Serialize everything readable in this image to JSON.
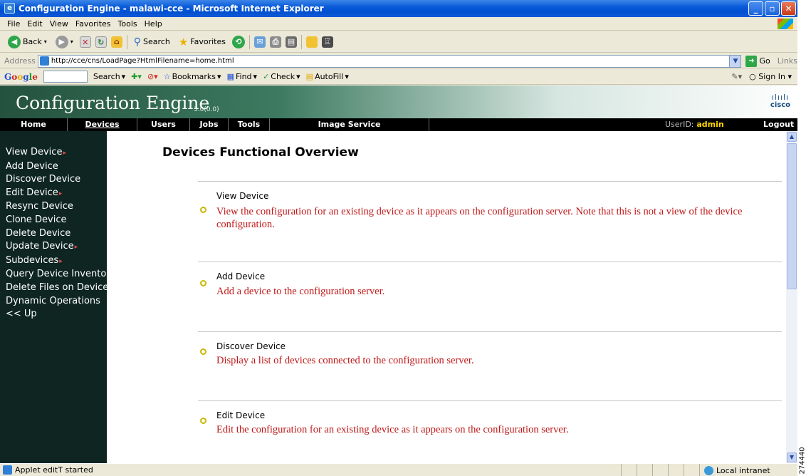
{
  "window": {
    "title": "Configuration Engine - malawi-cce - Microsoft Internet Explorer"
  },
  "menu": [
    "File",
    "Edit",
    "View",
    "Favorites",
    "Tools",
    "Help"
  ],
  "toolbar": {
    "back": "Back",
    "search": "Search",
    "favorites": "Favorites"
  },
  "address": {
    "label": "Address",
    "url": "http://cce/cns/LoadPage?HtmlFilename=home.html",
    "go": "Go",
    "links": "Links"
  },
  "google": {
    "logo": "Google",
    "search": "Search",
    "bookmarks": "Bookmarks",
    "find": "Find",
    "check": "Check",
    "autofill": "AutoFill",
    "signin": "Sign In"
  },
  "app": {
    "title": "Configuration Engine",
    "version": "3.0(0.0)",
    "logo_text": "cisco"
  },
  "nav": {
    "items": [
      "Home",
      "Devices",
      "Users",
      "Jobs",
      "Tools",
      "Image Service"
    ],
    "userid_label": "UserID:",
    "user": "admin",
    "logout": "Logout"
  },
  "sidebar": {
    "items": [
      "View Device",
      "Add Device",
      "Discover Device",
      "Edit Device",
      "Resync Device",
      "Clone Device",
      "Delete Device",
      "Update Device",
      "Subdevices",
      "Query Device Inventory",
      "Delete Files on Device",
      "Dynamic Operations",
      "<< Up"
    ]
  },
  "main": {
    "heading": "Devices Functional Overview",
    "sections": [
      {
        "name": "View Device",
        "desc": "View the configuration for an existing device as it appears on the configuration server. Note that this is not a view of the device configuration."
      },
      {
        "name": "Add Device",
        "desc": "Add a device to the configuration server."
      },
      {
        "name": "Discover Device",
        "desc": "Display a list of devices connected to the configuration server."
      },
      {
        "name": "Edit Device",
        "desc": "Edit the configuration for an existing device as it appears on the configuration server."
      }
    ]
  },
  "status": {
    "text": "Applet editT started",
    "zone": "Local intranet"
  },
  "figure_id": "274440"
}
